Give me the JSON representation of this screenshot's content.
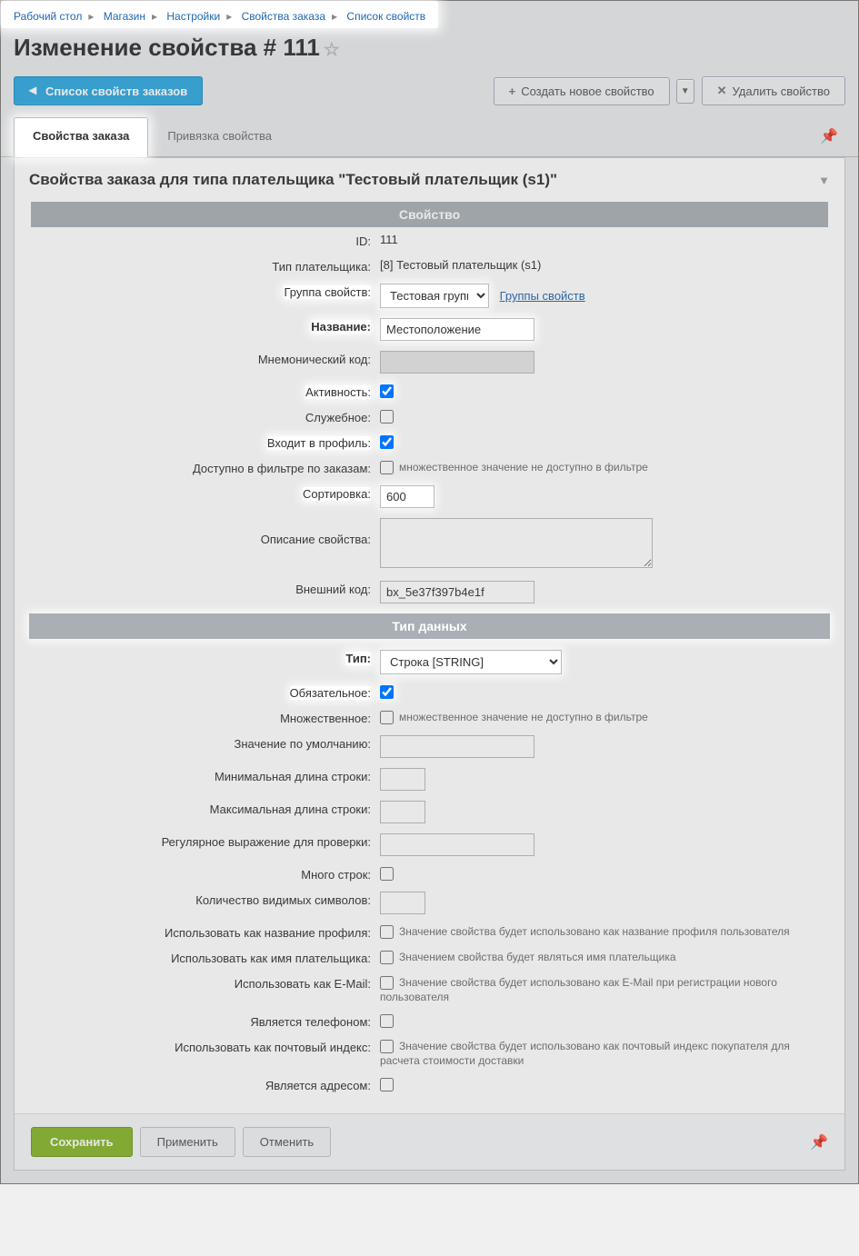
{
  "breadcrumb": [
    {
      "label": "Рабочий стол"
    },
    {
      "label": "Магазин"
    },
    {
      "label": "Настройки"
    },
    {
      "label": "Свойства заказа"
    },
    {
      "label": "Список свойств"
    }
  ],
  "page_title": "Изменение свойства # 111",
  "top_buttons": {
    "back": "Список свойств заказов",
    "create": "Создать новое свойство",
    "delete": "Удалить свойство"
  },
  "tabs": [
    {
      "label": "Свойства заказа",
      "active": true
    },
    {
      "label": "Привязка свойства",
      "active": false
    }
  ],
  "panel_title": "Свойства заказа для типа плательщика \"Тестовый плательщик (s1)\"",
  "sections": {
    "prop": "Свойство",
    "datatype": "Тип данных"
  },
  "fields": {
    "id_label": "ID:",
    "id_value": "111",
    "payer_type_label": "Тип плательщика:",
    "payer_type_value": "[8] Тестовый плательщик (s1)",
    "group_label": "Группа свойств:",
    "group_value": "Тестовая группа",
    "group_link": "Группы свойств",
    "name_label": "Название:",
    "name_value": "Местоположение",
    "code_label": "Мнемонический код:",
    "code_value": "",
    "active_label": "Активность:",
    "active_checked": true,
    "service_label": "Служебное:",
    "service_checked": false,
    "profile_label": "Входит в профиль:",
    "profile_checked": true,
    "filter_label": "Доступно в фильтре по заказам:",
    "filter_checked": false,
    "filter_note": "множественное значение не доступно в фильтре",
    "sort_label": "Сортировка:",
    "sort_value": "600",
    "desc_label": "Описание свойства:",
    "desc_value": "",
    "xml_label": "Внешний код:",
    "xml_value": "bx_5e37f397b4e1f",
    "type_label": "Тип:",
    "type_value": "Строка [STRING]",
    "required_label": "Обязательное:",
    "required_checked": true,
    "multiple_label": "Множественное:",
    "multiple_checked": false,
    "multiple_note": "множественное значение не доступно в фильтре",
    "default_label": "Значение по умолчанию:",
    "minlen_label": "Минимальная длина строки:",
    "maxlen_label": "Максимальная длина строки:",
    "regex_label": "Регулярное выражение для проверки:",
    "multiline_label": "Много строк:",
    "cols_label": "Количество видимых символов:",
    "is_profile_name_label": "Использовать как название профиля:",
    "is_profile_name_note": "Значение свойства будет использовано как название профиля пользователя",
    "is_payer_label": "Использовать как имя плательщика:",
    "is_payer_note": "Значением свойства будет являться имя плательщика",
    "is_email_label": "Использовать как E-Mail:",
    "is_email_note": "Значение свойства будет использовано как E-Mail при регистрации нового пользователя",
    "is_phone_label": "Является телефоном:",
    "is_zip_label": "Использовать как почтовый индекс:",
    "is_zip_note": "Значение свойства будет использовано как почтовый индекс покупателя для расчета стоимости доставки",
    "is_address_label": "Является адресом:"
  },
  "buttons": {
    "save": "Сохранить",
    "apply": "Применить",
    "cancel": "Отменить"
  }
}
